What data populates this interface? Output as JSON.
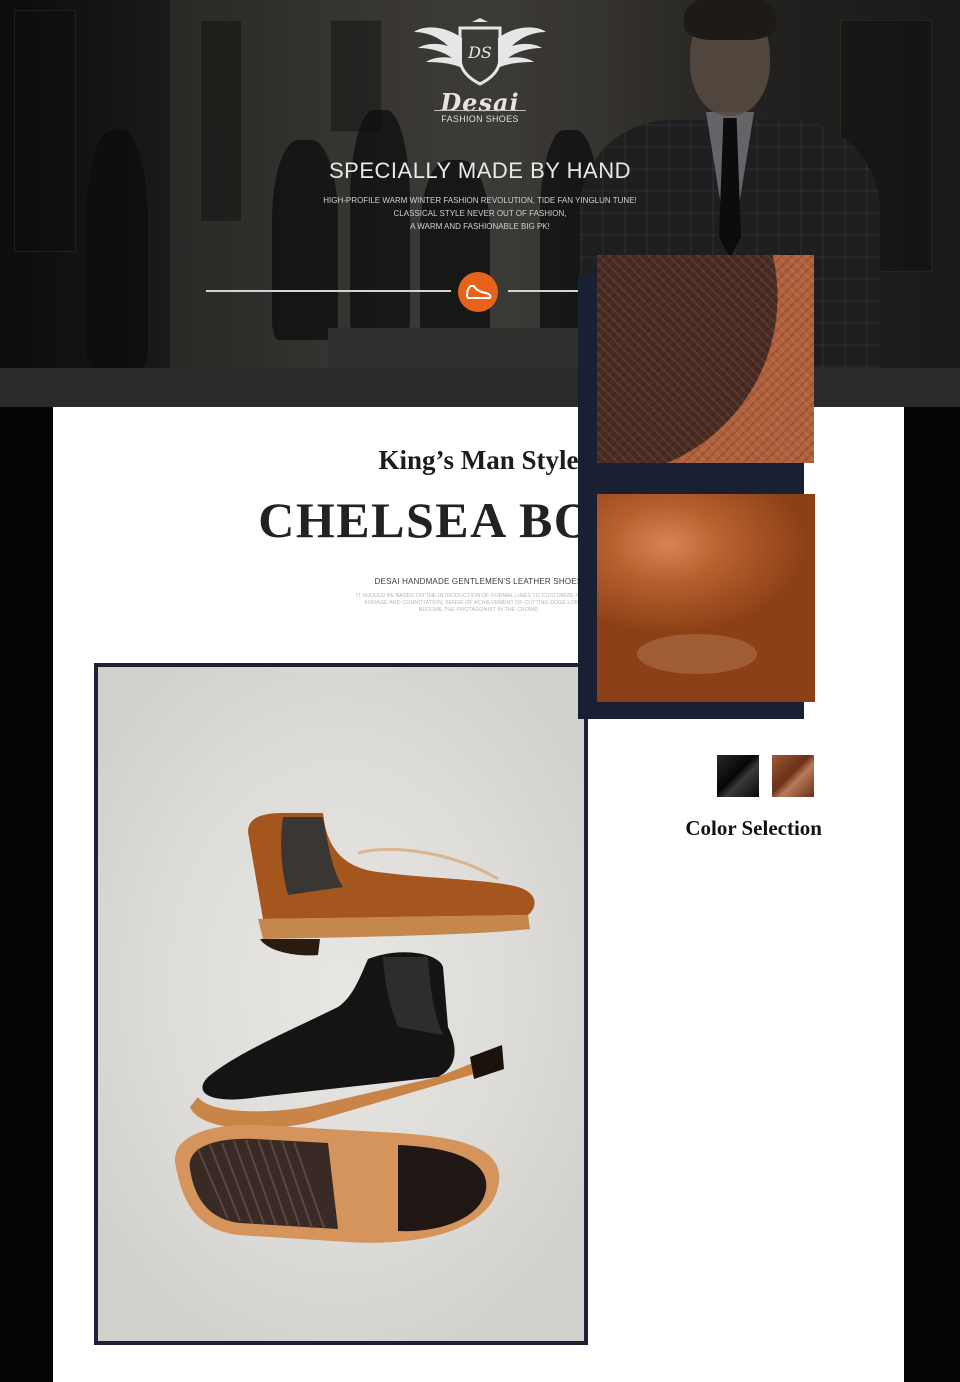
{
  "hero": {
    "brand": "Desai",
    "brand_sub": "FASHION SHOES",
    "title": "SPECIALLY MADE BY HAND",
    "lines": [
      "HIGH-PROFILE WARM WINTER FASHION REVOLUTION, TIDE FAN YINGLUN TUNE!",
      "CLASSICAL STYLE NEVER OUT OF FASHION,",
      "A WARM AND FASHIONABLE BIG PK!"
    ],
    "badge_icon": "shoe-icon",
    "accent": "#e8621c"
  },
  "product": {
    "subtitle": "King’s Man Style",
    "title": "CHELSEA BOOTS",
    "tagline": "DESAI HANDMADE GENTLEMEN'S LEATHER SHOES",
    "description": [
      "IT SHOULD BE BASED ON THE INTRODUCTION OF FORMAL LINES TO CUSTOMIZE FASHION,",
      "FORAGE AND CONNOTATION, SENSE OF ACHIEVEMENT OF CUTTING EDGE LOW KEY",
      "BECOME THE PROTAGONIST IN THE CROWD"
    ],
    "images": {
      "main": "chelsea-boots-photo",
      "detail_1": "sole-detail-photo",
      "detail_2": "leather-detail-photo"
    }
  },
  "colors": {
    "label": "Color Selection",
    "options": [
      {
        "name": "black",
        "hex": "#0a0a0a"
      },
      {
        "name": "brown",
        "hex": "#7a3a1c"
      }
    ]
  }
}
